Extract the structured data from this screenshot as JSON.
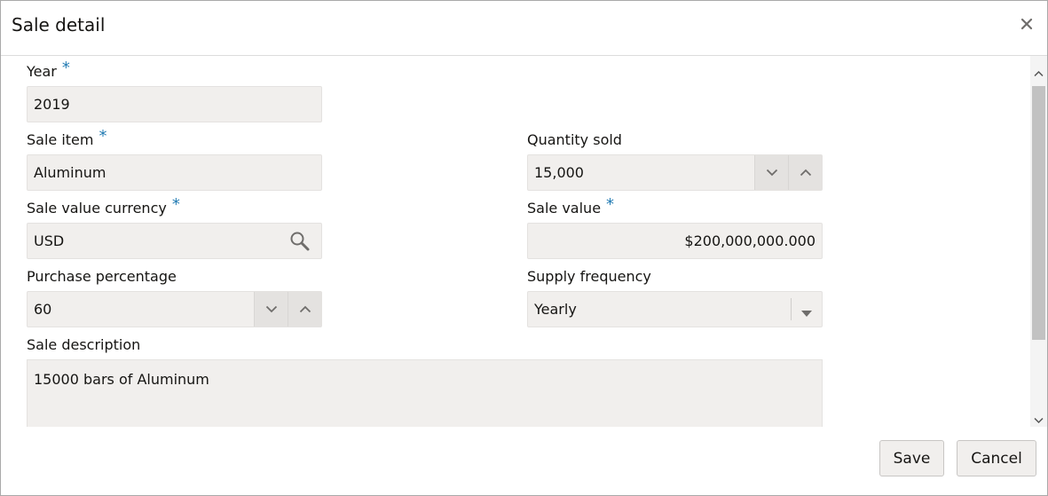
{
  "dialog": {
    "title": "Sale detail",
    "close_icon": "close-icon"
  },
  "form": {
    "year": {
      "label": "Year",
      "required": "*",
      "value": "2019"
    },
    "sale_item": {
      "label": "Sale item",
      "required": "*",
      "value": "Aluminum"
    },
    "quantity_sold": {
      "label": "Quantity sold",
      "value": "15,000",
      "icons": [
        "chevron-down-icon",
        "chevron-up-icon"
      ]
    },
    "sale_value_currency": {
      "label": "Sale value currency",
      "required": "*",
      "value": "USD",
      "icon": "search-icon"
    },
    "sale_value": {
      "label": "Sale value",
      "required": "*",
      "value": "$200,000,000.000"
    },
    "purchase_percentage": {
      "label": "Purchase percentage",
      "value": "60",
      "icons": [
        "chevron-down-icon",
        "chevron-up-icon"
      ]
    },
    "supply_frequency": {
      "label": "Supply frequency",
      "value": "Yearly",
      "icon": "dropdown-arrow-icon"
    },
    "sale_description": {
      "label": "Sale description",
      "value": "15000 bars of Aluminum"
    }
  },
  "footer": {
    "save_label": "Save",
    "cancel_label": "Cancel"
  },
  "colors": {
    "required_marker": "#227bb3",
    "field_background": "#f1efed",
    "spin_button": "#e4e2e0"
  }
}
